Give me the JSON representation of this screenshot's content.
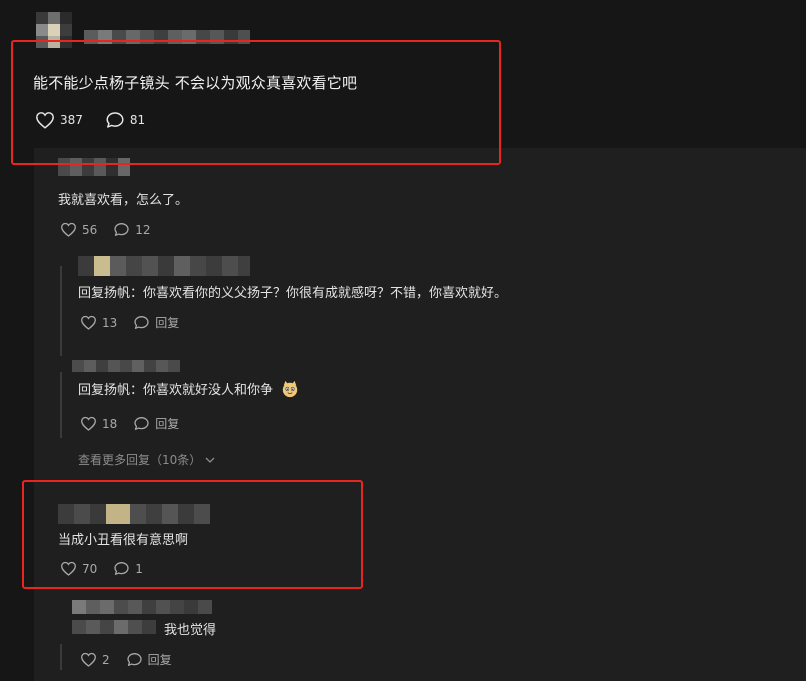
{
  "main_comment": {
    "text": "能不能少点杨子镜头 不会以为观众真喜欢看它吧",
    "likes": "387",
    "replies": "81"
  },
  "reply_1": {
    "text": "我就喜欢看，怎么了。",
    "likes": "56",
    "replies": "12"
  },
  "sub_reply_1": {
    "text": "回复扬帆：你喜欢看你的义父扬子？你很有成就感呀？不错，你喜欢就好。",
    "likes": "13",
    "reply_label": "回复"
  },
  "sub_reply_2": {
    "text": "回复扬帆：你喜欢就好没人和你争",
    "emoji": "cat-face-emoji",
    "likes": "18",
    "reply_label": "回复"
  },
  "more_replies": {
    "label": "查看更多回复（10条）"
  },
  "reply_2": {
    "text": "当成小丑看很有意思啊",
    "likes": "70",
    "replies": "1"
  },
  "reply_3": {
    "text": "我也觉得",
    "likes": "2",
    "reply_label": "回复"
  },
  "colors": {
    "background": "#161616",
    "panel": "#1f1f1f",
    "highlight": "#e8261f"
  }
}
